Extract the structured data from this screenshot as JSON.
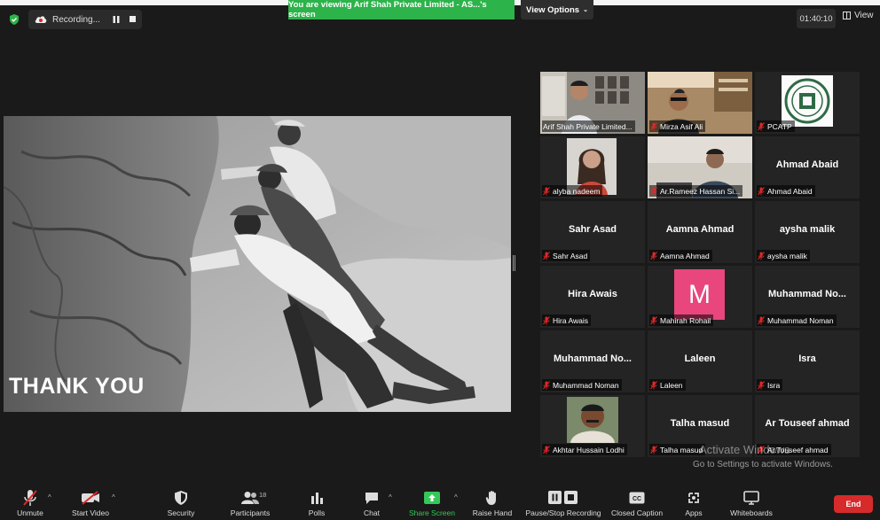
{
  "topbar": {
    "recording_label": "Recording...",
    "viewing_banner": "You are viewing Arif Shah Private Limited - AS...'s screen",
    "view_options_label": "View Options",
    "timer": "01:40:10",
    "view_label": "View"
  },
  "share": {
    "slide_text": "THANK YOU"
  },
  "participants": [
    {
      "name": "Arif Shah Private Limited...",
      "display": "",
      "type": "video"
    },
    {
      "name": "Mirza Asif Ali",
      "display": "",
      "type": "video"
    },
    {
      "name": "PCATP",
      "display": "",
      "type": "logo"
    },
    {
      "name": "alyba nadeem",
      "display": "",
      "type": "photo"
    },
    {
      "name": "Ar.Rameez Hassan Si...",
      "display": "",
      "type": "video"
    },
    {
      "name": "Ahmad Abaid",
      "display": "Ahmad Abaid",
      "type": "name"
    },
    {
      "name": "Sahr Asad",
      "display": "Sahr Asad",
      "type": "name"
    },
    {
      "name": "Aamna Ahmad",
      "display": "Aamna Ahmad",
      "type": "name"
    },
    {
      "name": "aysha malik",
      "display": "aysha malik",
      "type": "name"
    },
    {
      "name": "Hira Awais",
      "display": "Hira Awais",
      "type": "name"
    },
    {
      "name": "Mahirah Rohail",
      "display": "M",
      "type": "letter"
    },
    {
      "name": "Muhammad Noman",
      "display": "Muhammad  No...",
      "type": "name"
    },
    {
      "name": "Muhammad Noman",
      "display": "Muhammad  No...",
      "type": "name"
    },
    {
      "name": "Laleen",
      "display": "Laleen",
      "type": "name"
    },
    {
      "name": "Isra",
      "display": "Isra",
      "type": "name"
    },
    {
      "name": "Akhtar Hussain Lodhi",
      "display": "",
      "type": "photo"
    },
    {
      "name": "Talha masud",
      "display": "Talha masud",
      "type": "name"
    },
    {
      "name": "Ar.Touseef ahmad",
      "display": "Ar Touseef ahmad",
      "type": "name"
    }
  ],
  "watermark": {
    "title": "Activate Windows",
    "subtitle": "Go to Settings to activate Windows."
  },
  "toolbar": {
    "unmute": "Unmute",
    "start_video": "Start Video",
    "security": "Security",
    "participants": "Participants",
    "participants_count": "18",
    "polls": "Polls",
    "chat": "Chat",
    "share_screen": "Share Screen",
    "raise_hand": "Raise Hand",
    "pause_stop_recording": "Pause/Stop Recording",
    "closed_caption": "Closed Caption",
    "apps": "Apps",
    "whiteboards": "Whiteboards",
    "end": "End"
  },
  "colors": {
    "background": "#1a1a1a",
    "tile": "#242424",
    "banner_green": "#2cb34a",
    "active_speaker": "#c6e23a",
    "mute_red": "#e02828",
    "end_red": "#d72b2b",
    "avatar_pink": "#e8467c"
  },
  "icons": [
    "shield-icon",
    "cloud-record-icon",
    "pause-icon",
    "stop-icon",
    "grid-view-icon",
    "muted-mic-icon",
    "video-off-icon",
    "security-shield-icon",
    "participants-icon",
    "polls-icon",
    "chat-icon",
    "share-screen-icon",
    "raise-hand-icon",
    "cc-icon",
    "apps-icon",
    "whiteboard-icon"
  ]
}
